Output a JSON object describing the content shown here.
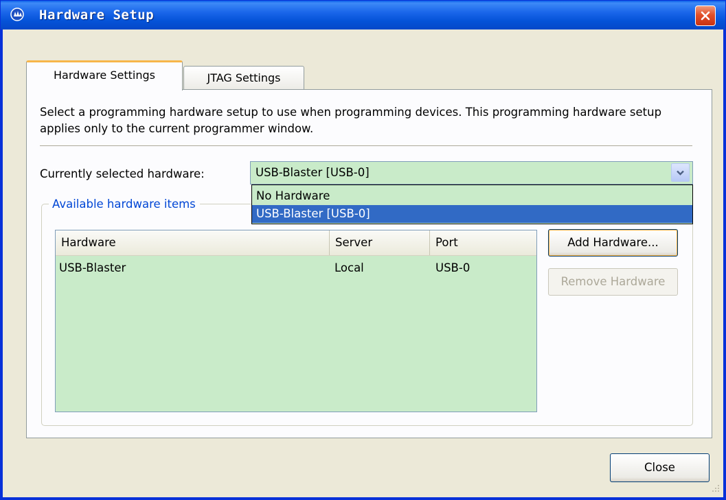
{
  "window": {
    "title": "Hardware Setup"
  },
  "tabs": [
    {
      "label": "Hardware Settings",
      "active": true
    },
    {
      "label": "JTAG Settings",
      "active": false
    }
  ],
  "description": "Select a programming hardware setup to use when programming devices. This programming hardware setup applies only to the current programmer window.",
  "current_hardware": {
    "label": "Currently selected hardware:",
    "value": "USB-Blaster [USB-0]",
    "options": [
      "No Hardware",
      "USB-Blaster [USB-0]"
    ],
    "highlighted_option": "USB-Blaster [USB-0]"
  },
  "available": {
    "group_label": "Available hardware items",
    "columns": [
      "Hardware",
      "Server",
      "Port"
    ],
    "rows": [
      {
        "hardware": "USB-Blaster",
        "server": "Local",
        "port": "USB-0"
      }
    ]
  },
  "buttons": {
    "add": "Add Hardware...",
    "remove": "Remove Hardware",
    "close": "Close"
  },
  "colors": {
    "titlebar": "#0553d8",
    "list_bg": "#c9ebc9",
    "selection": "#316ac5",
    "group_label": "#0046d5"
  }
}
